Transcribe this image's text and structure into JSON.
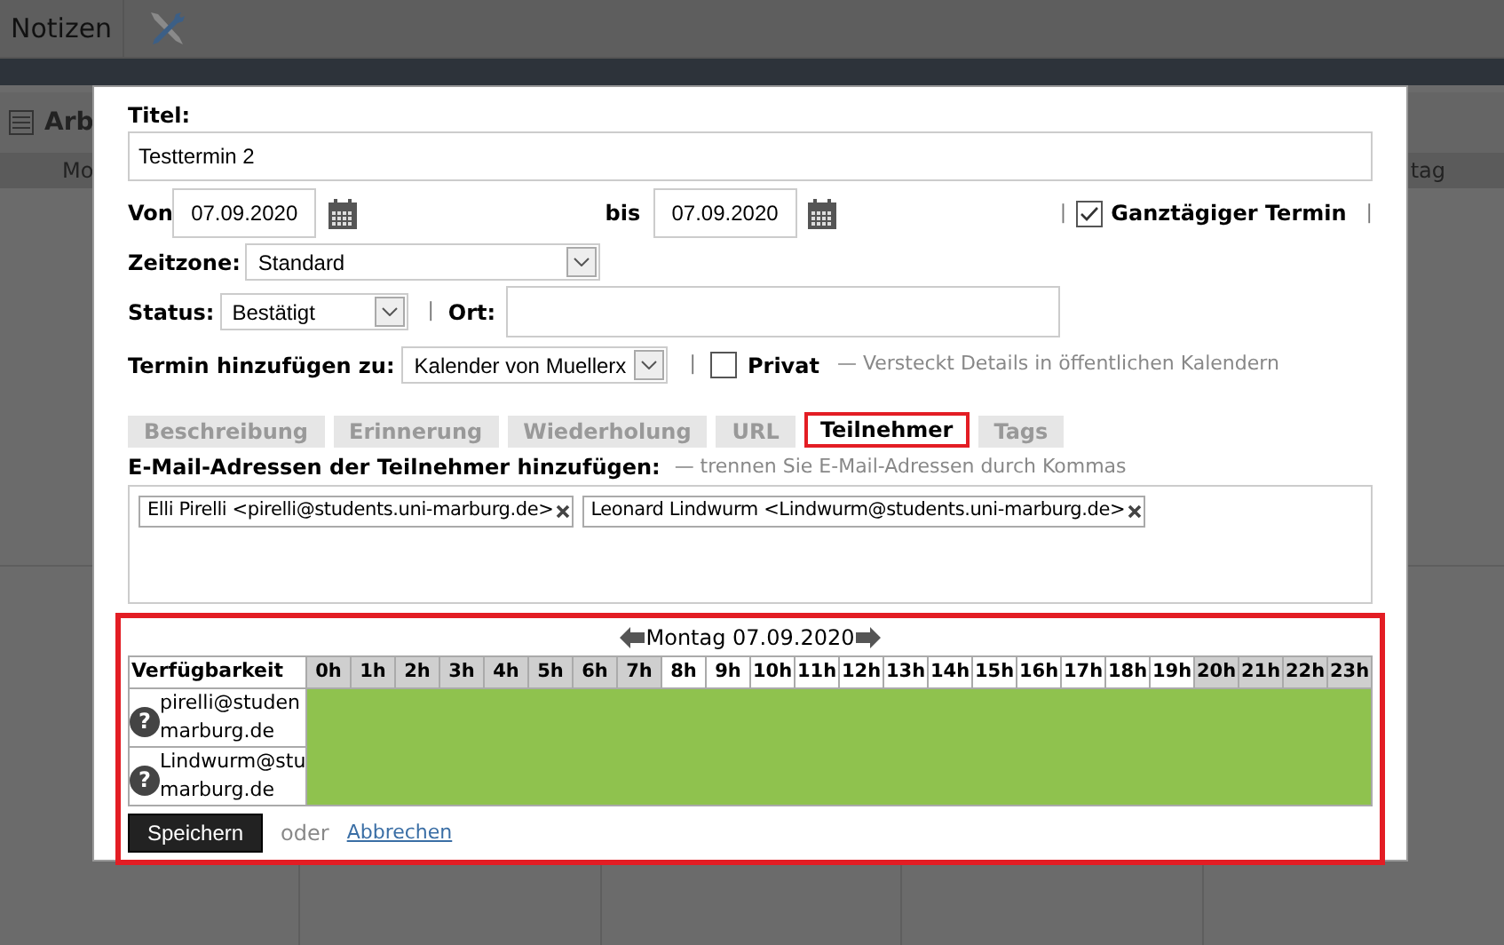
{
  "toolbar": {
    "label": "Notizen"
  },
  "background": {
    "panel_title": "Arb",
    "column_headers": [
      "Mo",
      "tag"
    ]
  },
  "dialog": {
    "separators": [
      "|",
      "|",
      "|",
      "|"
    ],
    "title_label": "Titel:",
    "title_value": "Testtermin 2",
    "from_label": "Von",
    "from_value": "07.09.2020",
    "to_label": "bis",
    "to_value": "07.09.2020",
    "all_day": {
      "label": "Ganztägiger Termin",
      "checked": true
    },
    "timezone_label": "Zeitzone:",
    "timezone_value": "Standard",
    "status_label": "Status:",
    "status_value": "Bestätigt",
    "location_label": "Ort:",
    "calendar_label": "Termin hinzufügen zu:",
    "calendar_value": "Kalender von Muellerx",
    "private": {
      "label": "Privat",
      "checked": false,
      "hint": "— Versteckt Details in öffentlichen Kalendern"
    },
    "tabs": [
      {
        "label": "Beschreibung",
        "selected": false
      },
      {
        "label": "Erinnerung",
        "selected": false
      },
      {
        "label": "Wiederholung",
        "selected": false
      },
      {
        "label": "URL",
        "selected": false
      },
      {
        "label": "Teilnehmer",
        "selected": true
      },
      {
        "label": "Tags",
        "selected": false
      }
    ],
    "attendees_label": "E-Mail-Adressen der Teilnehmer hinzufügen:",
    "attendees_hint": "— trennen Sie E-Mail-Adressen durch Kommas",
    "attendees": [
      {
        "text": "Elli Pirelli <pirelli@students.uni-marburg.de>"
      },
      {
        "text": "Leonard Lindwurm <Lindwurm@students.uni-marburg.de>"
      }
    ],
    "availability": {
      "date": "Montag 07.09.2020",
      "header": "Verfügbarkeit",
      "hours": [
        {
          "label": "0h",
          "off_hours": true
        },
        {
          "label": "1h",
          "off_hours": true
        },
        {
          "label": "2h",
          "off_hours": true
        },
        {
          "label": "3h",
          "off_hours": true
        },
        {
          "label": "4h",
          "off_hours": true
        },
        {
          "label": "5h",
          "off_hours": true
        },
        {
          "label": "6h",
          "off_hours": true
        },
        {
          "label": "7h",
          "off_hours": true
        },
        {
          "label": "8h",
          "off_hours": false
        },
        {
          "label": "9h",
          "off_hours": false
        },
        {
          "label": "10h",
          "off_hours": false
        },
        {
          "label": "11h",
          "off_hours": false
        },
        {
          "label": "12h",
          "off_hours": false
        },
        {
          "label": "13h",
          "off_hours": false
        },
        {
          "label": "14h",
          "off_hours": false
        },
        {
          "label": "15h",
          "off_hours": false
        },
        {
          "label": "16h",
          "off_hours": false
        },
        {
          "label": "17h",
          "off_hours": false
        },
        {
          "label": "18h",
          "off_hours": false
        },
        {
          "label": "19h",
          "off_hours": false
        },
        {
          "label": "20h",
          "off_hours": true
        },
        {
          "label": "21h",
          "off_hours": true
        },
        {
          "label": "22h",
          "off_hours": true
        },
        {
          "label": "23h",
          "off_hours": true
        }
      ],
      "rows": [
        {
          "status_icon": "?",
          "lines": [
            "pirelli@studen",
            "marburg.de"
          ]
        },
        {
          "status_icon": "?",
          "lines": [
            "Lindwurm@stu",
            "marburg.de"
          ]
        }
      ]
    },
    "save": "Speichern",
    "or": "oder",
    "cancel": "Abbrechen"
  }
}
